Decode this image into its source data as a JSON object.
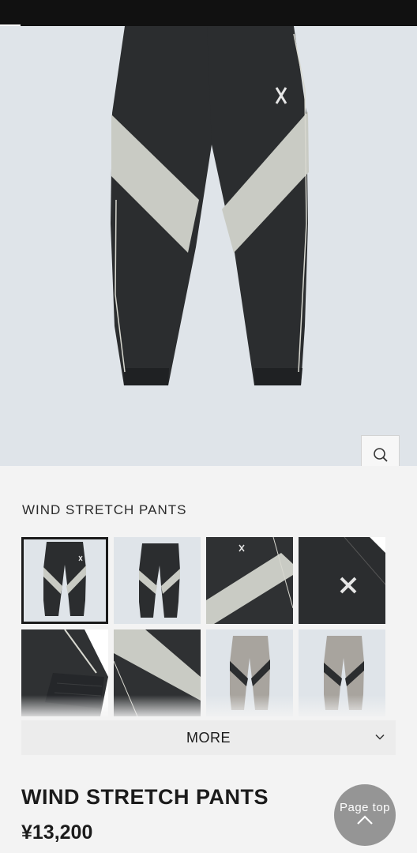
{
  "product": {
    "subtitle": "WIND STRETCH PANTS",
    "title": "WIND STRETCH PANTS",
    "price": "¥13,200"
  },
  "gallery": {
    "zoom_icon": "search-icon",
    "thumbnails": [
      {
        "name": "front-view",
        "selected": true
      },
      {
        "name": "front-view-alt",
        "selected": false
      },
      {
        "name": "panel-detail",
        "selected": false
      },
      {
        "name": "logo-detail",
        "selected": false
      },
      {
        "name": "cuff-detail",
        "selected": false
      },
      {
        "name": "stripe-detail",
        "selected": false
      },
      {
        "name": "gray-colorway-front",
        "selected": false
      },
      {
        "name": "gray-colorway-alt",
        "selected": false
      }
    ]
  },
  "more_button": {
    "label": "MORE",
    "icon": "chevron-down-icon"
  },
  "page_top": {
    "label": "Page top",
    "icon": "chevron-up-icon"
  },
  "colors": {
    "header": "#111111",
    "background": "#f3f3f3",
    "hero_background": "#dfe4e9",
    "pants_dark": "#2b2d2f",
    "pants_panel": "#c9cbc4",
    "pants_gray": "#a8a49e"
  }
}
